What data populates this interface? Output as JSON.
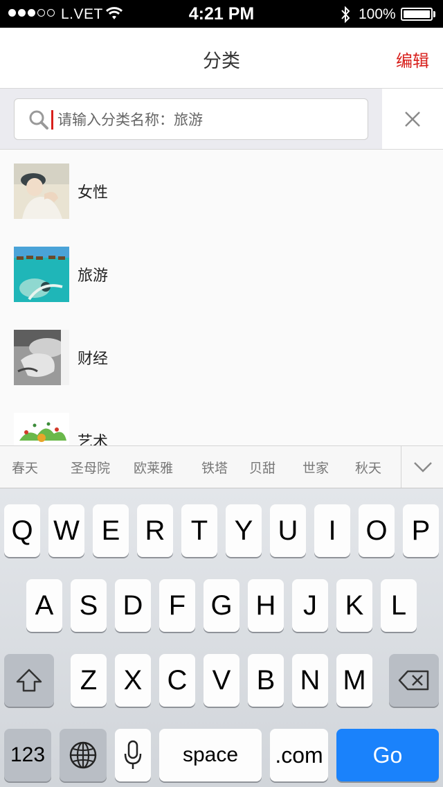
{
  "status_bar": {
    "carrier": "L.VET",
    "time": "4:21 PM",
    "battery": "100%"
  },
  "nav": {
    "title": "分类",
    "edit_label": "编辑"
  },
  "search": {
    "placeholder": "请输入分类名称：旅游",
    "value": ""
  },
  "categories": [
    {
      "label": "女性"
    },
    {
      "label": "旅游"
    },
    {
      "label": "财经"
    },
    {
      "label": "艺术"
    }
  ],
  "suggestions": [
    "春天",
    "圣母院",
    "欧莱雅",
    "铁塔",
    "贝甜",
    "世家",
    "秋天"
  ],
  "keyboard": {
    "row1": [
      "Q",
      "W",
      "E",
      "R",
      "T",
      "Y",
      "U",
      "I",
      "O",
      "P"
    ],
    "row2": [
      "A",
      "S",
      "D",
      "F",
      "G",
      "H",
      "J",
      "K",
      "L"
    ],
    "row3": [
      "Z",
      "X",
      "C",
      "V",
      "B",
      "N",
      "M"
    ],
    "numbers_label": "123",
    "space_label": "space",
    "dotcom_label": ".com",
    "go_label": "Go"
  },
  "colors": {
    "accent_red": "#d8201c",
    "go_blue": "#1a82fb"
  }
}
